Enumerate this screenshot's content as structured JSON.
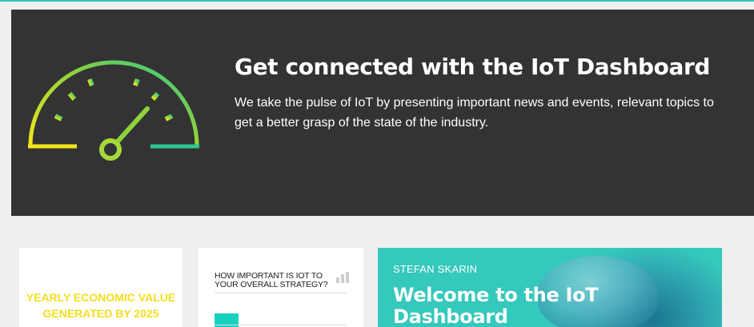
{
  "colors": {
    "accent": "#2ec4b6",
    "hero_bg": "#333333",
    "econ_text": "#f2de1e",
    "poll_bar": "#18d1bf",
    "welcome_bg": "#35c8bc"
  },
  "hero": {
    "icon": "speedometer-gauge-icon",
    "title": "Get connected with the IoT Dashboard",
    "description": "We take the pulse of IoT by presenting important news and events, relevant topics to get a better grasp of the state of the industry."
  },
  "cards": {
    "economic": {
      "label": "YEARLY ECONOMIC VALUE GENERATED BY 2025"
    },
    "poll": {
      "question": "How important is IoT to your overall strategy?",
      "icon": "bar-chart-icon"
    },
    "welcome": {
      "author": "STEFAN SKARIN",
      "title": "Welcome to the IoT Dashboard"
    }
  }
}
